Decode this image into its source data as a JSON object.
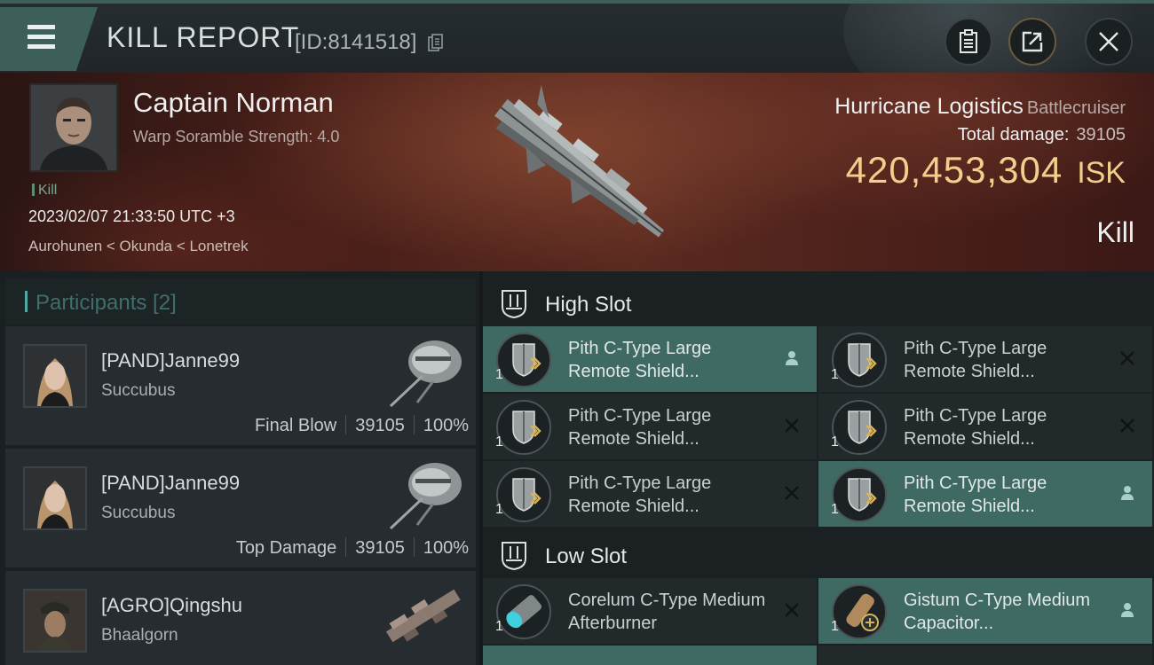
{
  "titlebar": {
    "title": "KILL REPORT",
    "report_id": "[ID:8141518]"
  },
  "victim": {
    "name": "Captain Norman",
    "warp_scramble": "Warp Soramble Strength: 4.0",
    "kill_tag": "Kill",
    "datetime": "2023/02/07 21:33:50 UTC +3",
    "location": "Aurohunen < Okunda < Lonetrek",
    "ship_name": "Hurricane Logistics",
    "ship_class": "Battlecruiser",
    "total_damage_label": "Total damage:",
    "total_damage": "39105",
    "isk_value": "420,453,304",
    "isk_unit": "ISK",
    "result": "Kill"
  },
  "participants": {
    "title": "Participants [2]",
    "items": [
      {
        "name": "[PAND]Janne99",
        "ship": "Succubus",
        "role": "Final Blow",
        "damage": "39105",
        "percent": "100%"
      },
      {
        "name": "[PAND]Janne99",
        "ship": "Succubus",
        "role": "Top Damage",
        "damage": "39105",
        "percent": "100%"
      },
      {
        "name": "[AGRO]Qingshu",
        "ship": "Bhaalgorn",
        "role": "",
        "damage": "",
        "percent": ""
      }
    ]
  },
  "fitting": {
    "high_slot_title": "High Slot",
    "low_slot_title": "Low Slot",
    "high": [
      {
        "name": "Pith C-Type Large Remote Shield...",
        "qty": "1",
        "state": "person-icon"
      },
      {
        "name": "Pith C-Type Large Remote Shield...",
        "qty": "1",
        "state": "close-icon"
      },
      {
        "name": "Pith C-Type Large Remote Shield...",
        "qty": "1",
        "state": "close-icon"
      },
      {
        "name": "Pith C-Type Large Remote Shield...",
        "qty": "1",
        "state": "close-icon"
      },
      {
        "name": "Pith C-Type Large Remote Shield...",
        "qty": "1",
        "state": "close-icon"
      },
      {
        "name": "Pith C-Type Large Remote Shield...",
        "qty": "1",
        "state": "person-icon"
      }
    ],
    "low": [
      {
        "name": "Corelum C-Type Medium Afterburner",
        "qty": "1",
        "state": "close-icon"
      },
      {
        "name": "Gistum C-Type Medium Capacitor...",
        "qty": "1",
        "state": "person-icon"
      }
    ]
  },
  "colors": {
    "accent_teal": "#3f6a64",
    "isk_gold": "#f2cf8a",
    "hero_red": "#5b2a20"
  }
}
